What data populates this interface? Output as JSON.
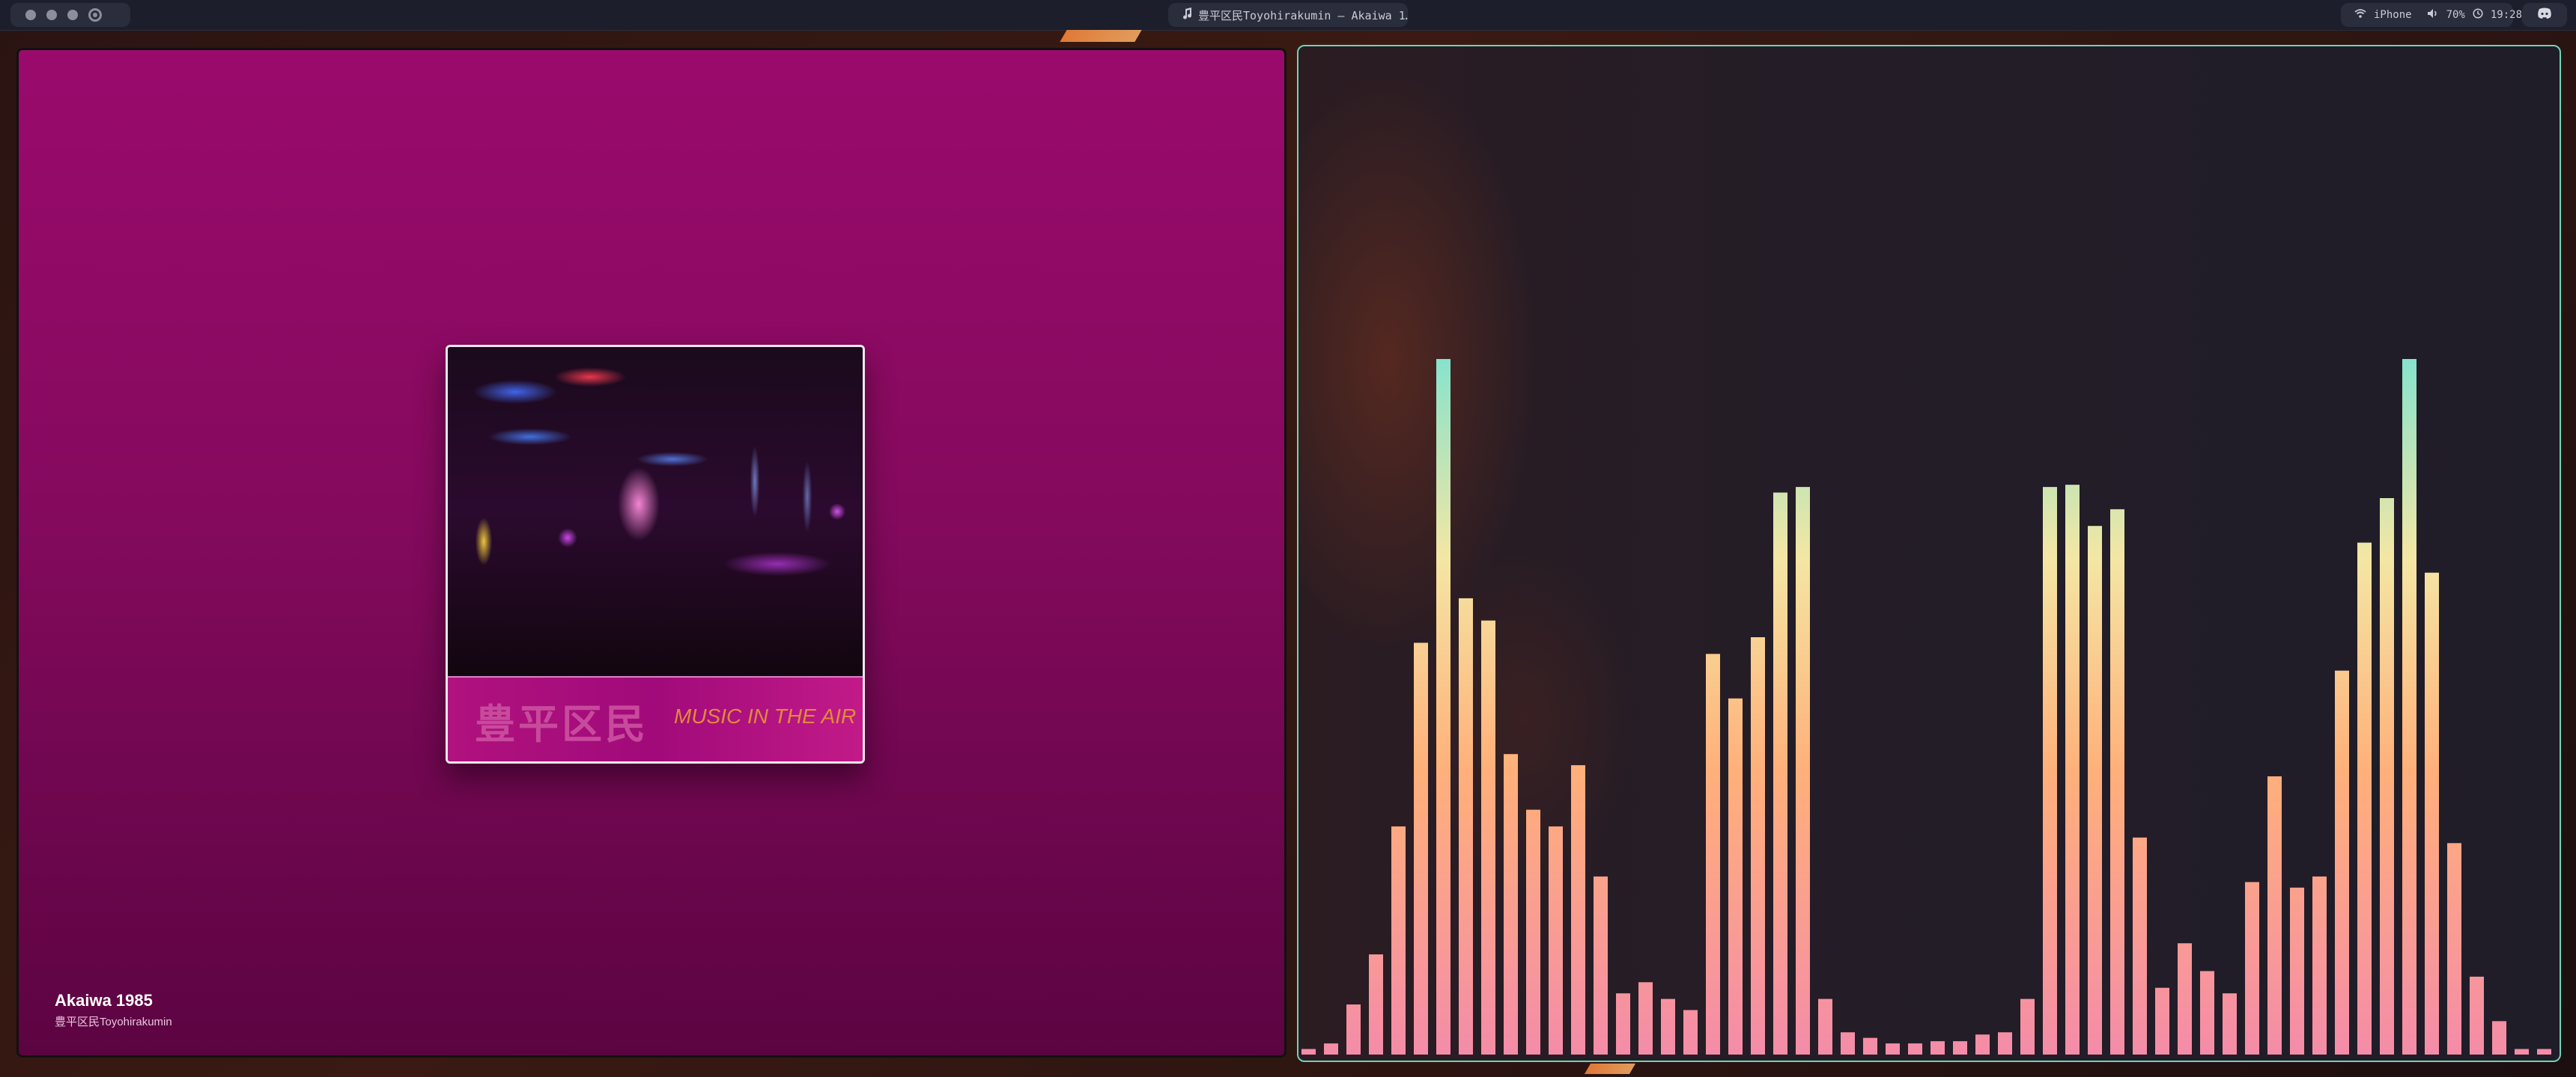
{
  "topbar": {
    "window_title": "豊平区民Toyohirakumin — Akaiwa 1…",
    "wifi_label": "iPhone",
    "volume_label": "70%",
    "clock": "19:28"
  },
  "player": {
    "track_title": "Akaiwa 1985",
    "track_artist": "豊平区民Toyohirakumin",
    "album_art_text_jp": "豊平区民",
    "album_art_text_en": "MUSIC IN THE AIR"
  },
  "visualizer": {
    "colors": {
      "top": "#7fe3cf",
      "mid": "#f4e6a4",
      "low": "#ffb07a",
      "bottom": "#f48ca8"
    },
    "values": [
      0.005,
      0.01,
      0.045,
      0.09,
      0.205,
      0.37,
      0.625,
      0.41,
      0.39,
      0.27,
      0.22,
      0.205,
      0.26,
      0.16,
      0.055,
      0.065,
      0.05,
      0.04,
      0.36,
      0.32,
      0.375,
      0.505,
      0.51,
      0.05,
      0.02,
      0.015,
      0.01,
      0.01,
      0.012,
      0.012,
      0.018,
      0.02,
      0.05,
      0.51,
      0.512,
      0.475,
      0.49,
      0.195,
      0.06,
      0.1,
      0.075,
      0.055,
      0.155,
      0.25,
      0.15,
      0.16,
      0.345,
      0.46,
      0.5,
      0.625,
      0.433,
      0.19,
      0.07,
      0.03,
      0.005,
      0.005
    ]
  },
  "icons": {
    "music_note": "music-note-icon",
    "wifi": "wifi-icon",
    "volume": "volume-icon",
    "clock": "clock-icon",
    "discord": "discord-icon"
  }
}
